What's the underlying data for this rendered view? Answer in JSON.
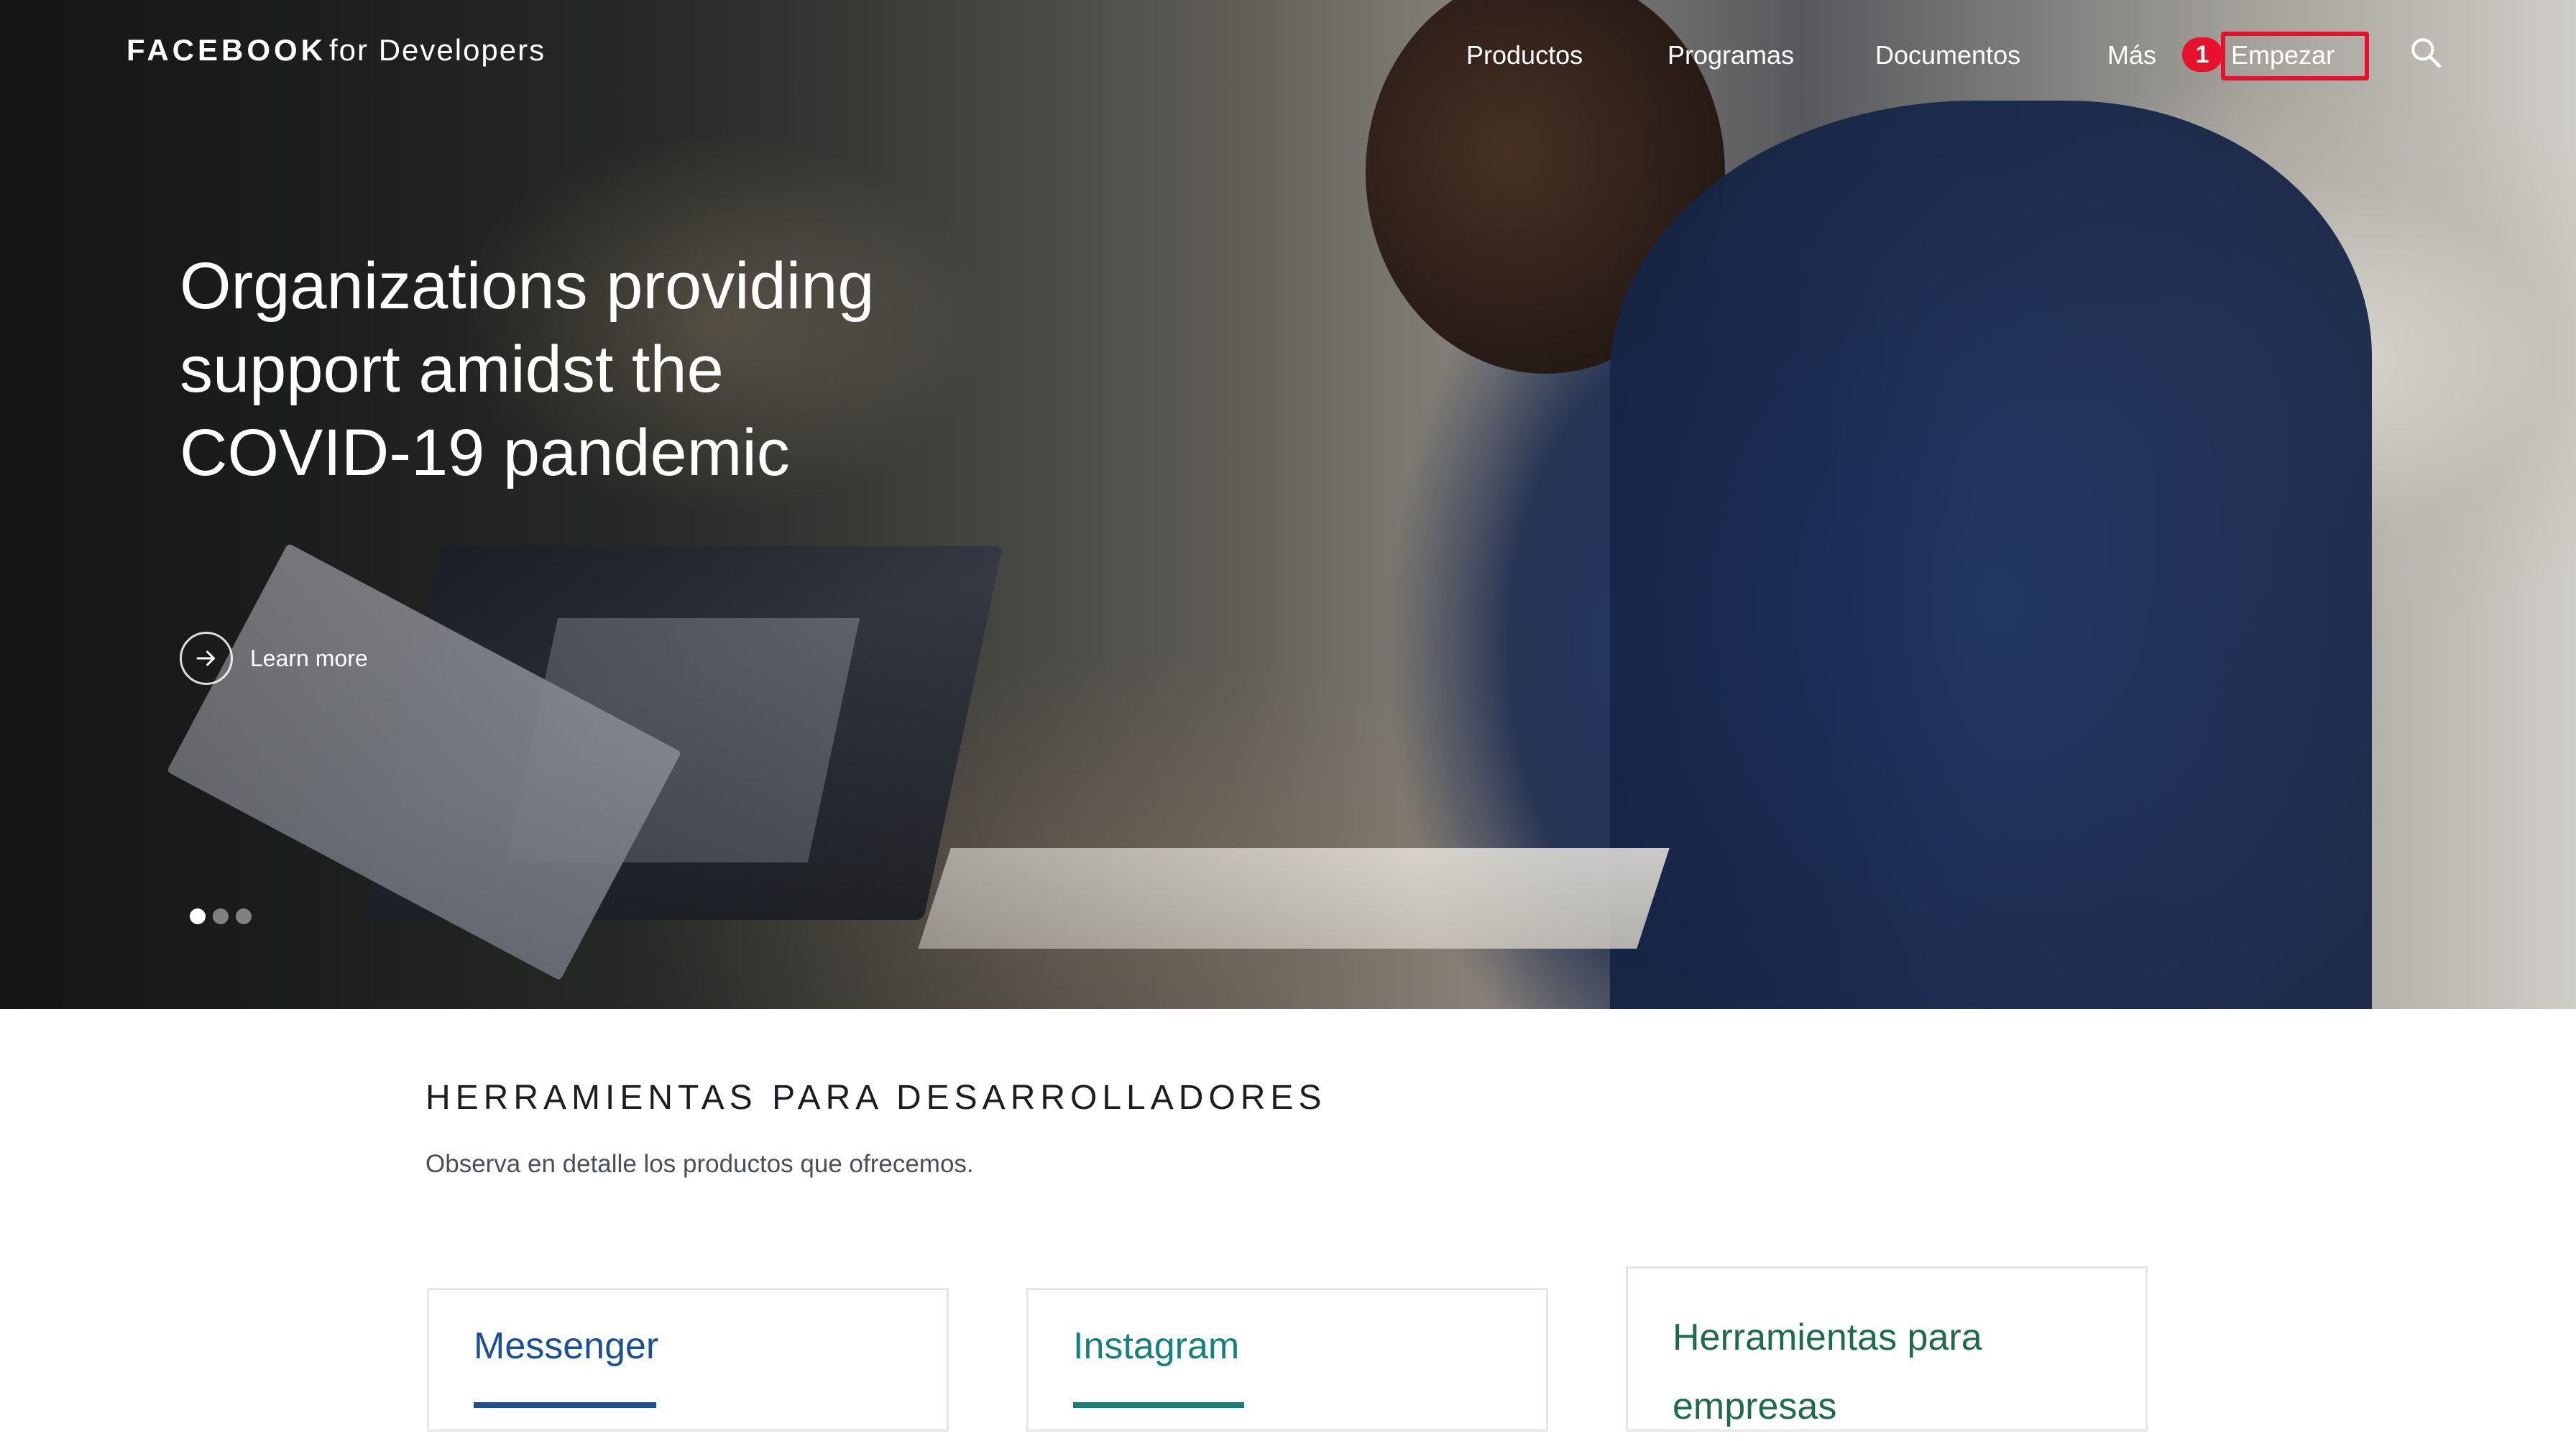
{
  "header": {
    "logo_brand": "FACEBOOK",
    "logo_sub": "for Developers",
    "nav": {
      "productos": "Productos",
      "programas": "Programas",
      "documentos": "Documentos",
      "mas": "Más",
      "empezar": "Empezar"
    },
    "badge": "1",
    "search_icon": "search-icon"
  },
  "hero": {
    "title": "Organizations providing support amidst the COVID-19 pandemic",
    "learn_more": "Learn more",
    "carousel_total": 3,
    "carousel_active": 1
  },
  "section": {
    "title": "HERRAMIENTAS PARA DESARROLLADORES",
    "subtitle": "Observa en detalle los productos que ofrecemos."
  },
  "cards": [
    {
      "title": "Messenger"
    },
    {
      "title": "Instagram"
    },
    {
      "title": "Herramientas para empresas"
    }
  ],
  "colors": {
    "accent_red": "#e8112d",
    "messenger_blue": "#1b4f96",
    "instagram_teal": "#17807a",
    "business_green": "#1d6b4a"
  }
}
